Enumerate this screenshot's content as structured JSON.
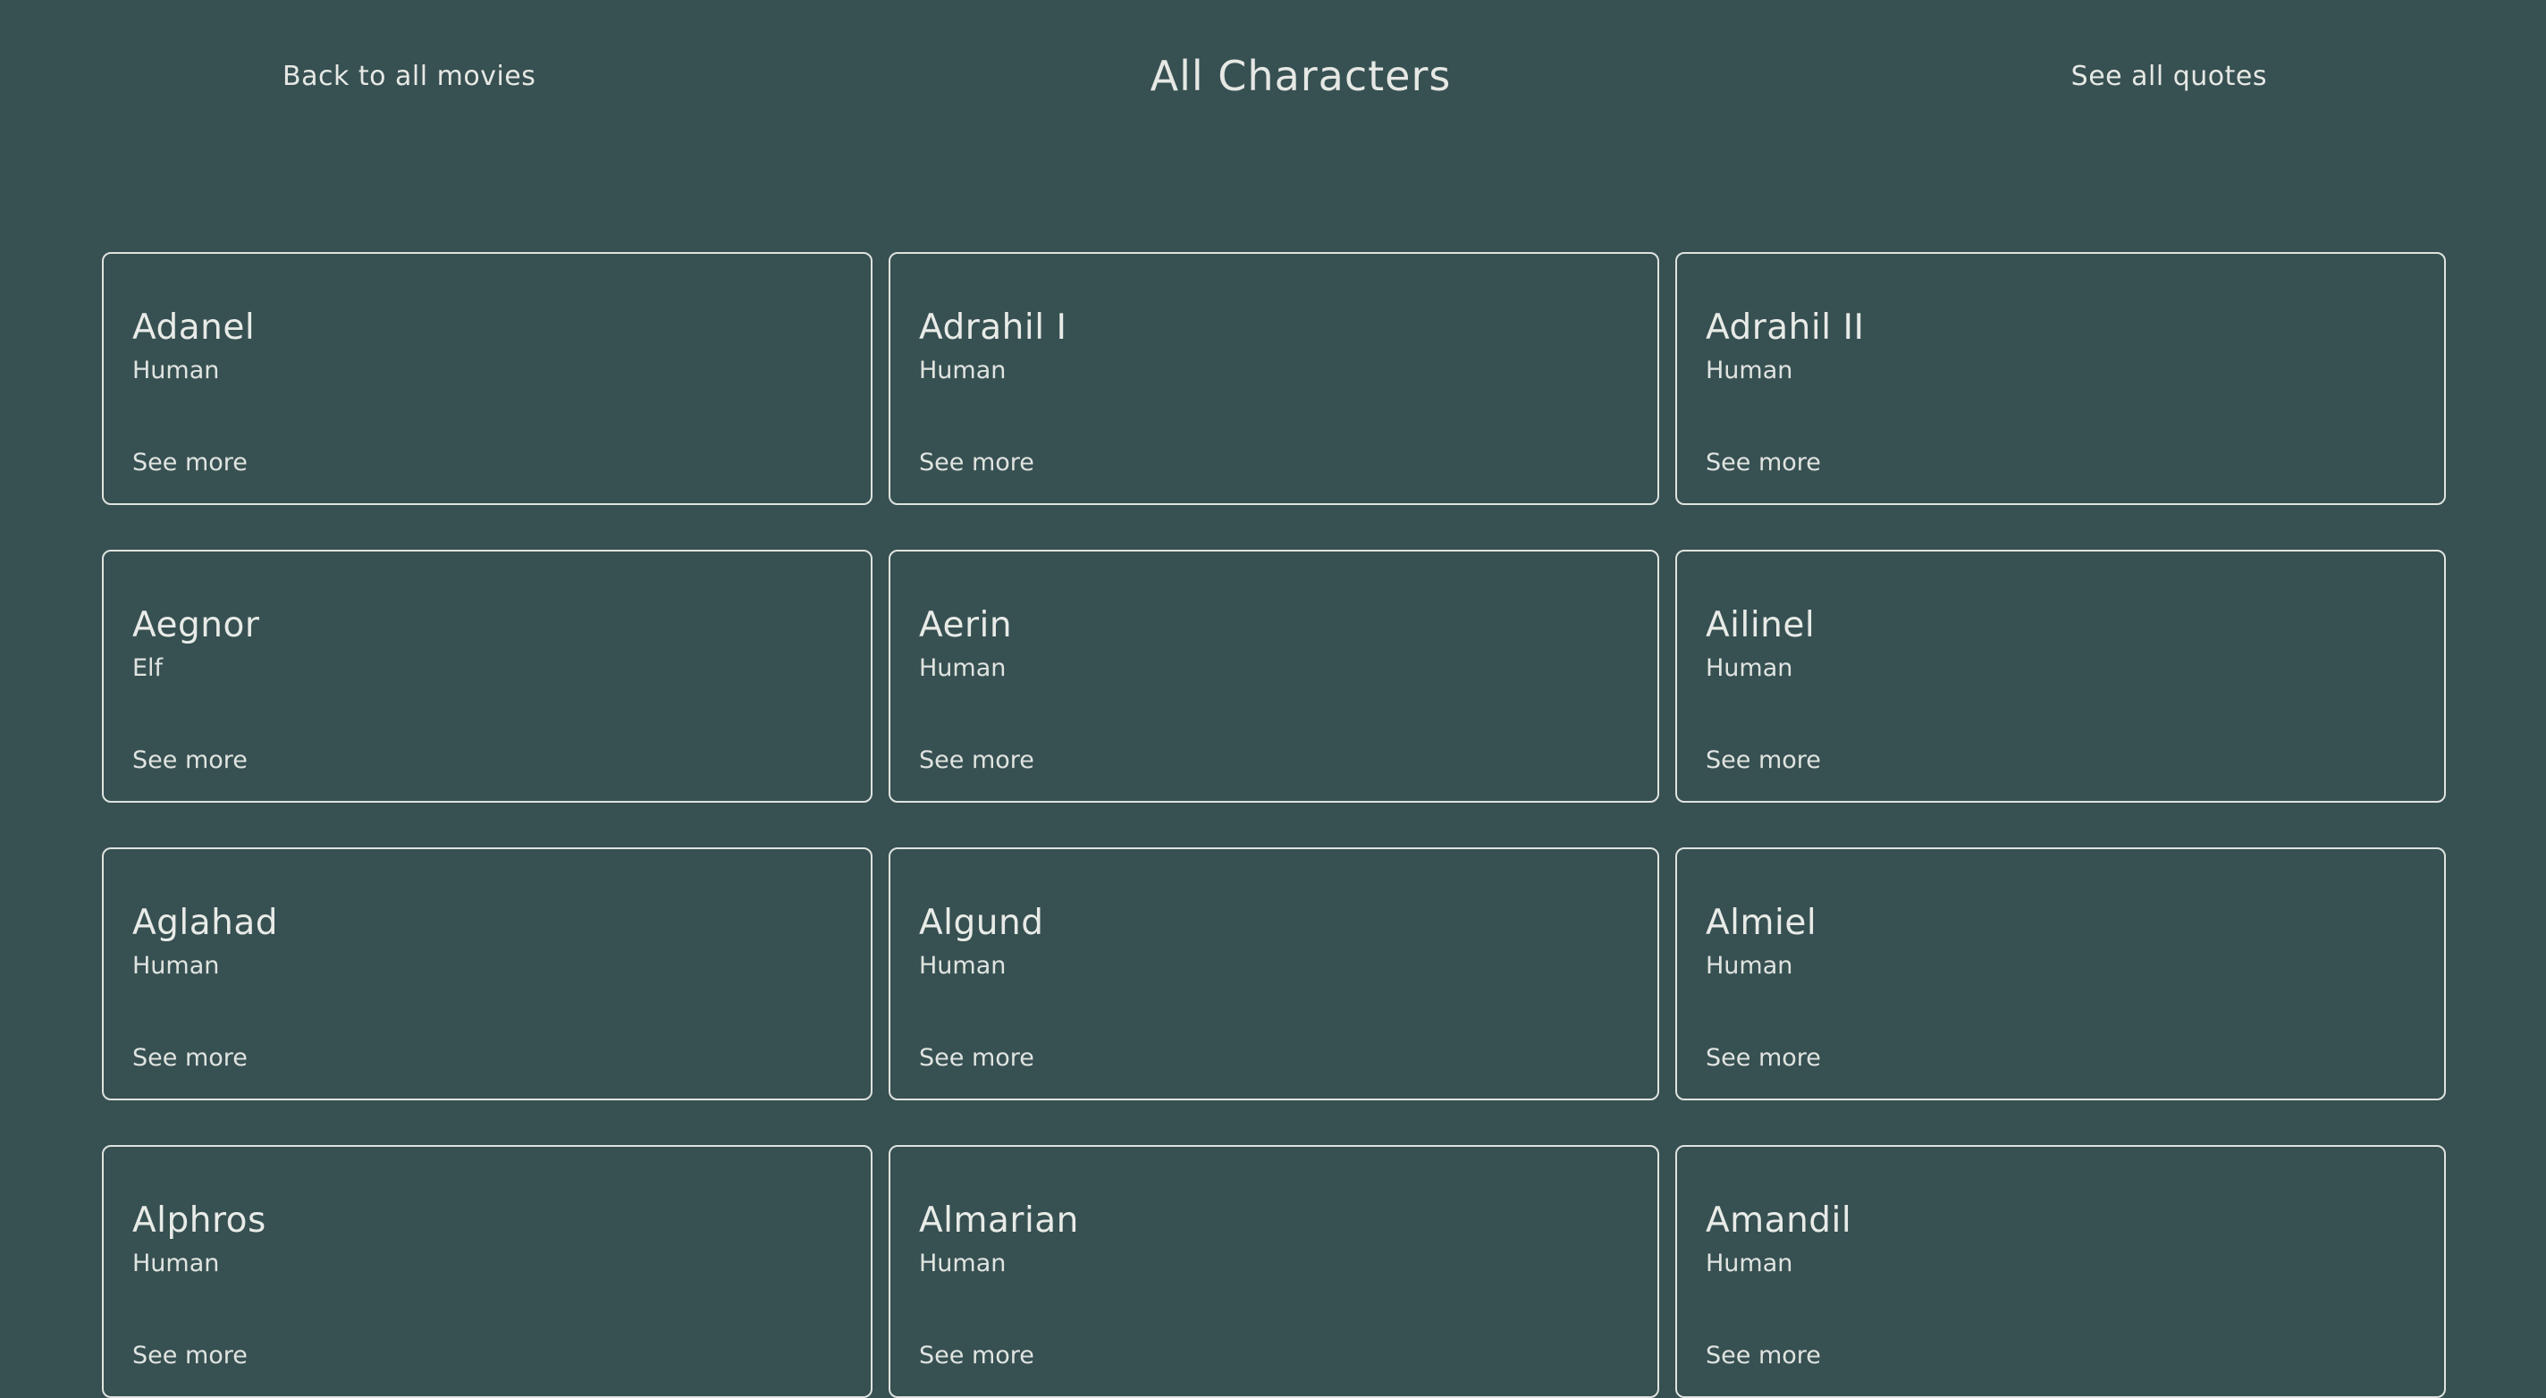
{
  "header": {
    "back_link": "Back to all movies",
    "title": "All Characters",
    "quotes_link": "See all quotes"
  },
  "colors": {
    "background": "#375052",
    "text": "#e6e8e4",
    "card_border": "#dfe3df"
  },
  "characters": [
    {
      "name": "Adanel",
      "race": "Human",
      "link": "See more"
    },
    {
      "name": "Adrahil I",
      "race": "Human",
      "link": "See more"
    },
    {
      "name": "Adrahil II",
      "race": "Human",
      "link": "See more"
    },
    {
      "name": "Aegnor",
      "race": "Elf",
      "link": "See more"
    },
    {
      "name": "Aerin",
      "race": "Human",
      "link": "See more"
    },
    {
      "name": "Ailinel",
      "race": "Human",
      "link": "See more"
    },
    {
      "name": "Aglahad",
      "race": "Human",
      "link": "See more"
    },
    {
      "name": "Algund",
      "race": "Human",
      "link": "See more"
    },
    {
      "name": "Almiel",
      "race": "Human",
      "link": "See more"
    },
    {
      "name": "Alphros",
      "race": "Human",
      "link": "See more"
    },
    {
      "name": "Almarian",
      "race": "Human",
      "link": "See more"
    },
    {
      "name": "Amandil",
      "race": "Human",
      "link": "See more"
    }
  ]
}
